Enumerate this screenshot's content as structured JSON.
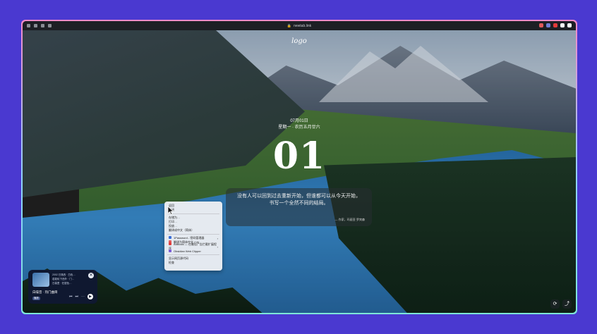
{
  "browser": {
    "url": "newtab.link",
    "extensions_colors": [
      "#e05a5a",
      "#6f7dd6",
      "#e23b3b",
      "#ffffff",
      "#ffffff"
    ]
  },
  "page": {
    "logo": "logo",
    "date_line1": "07月01日",
    "date_line2": "星期一 · 农历五月廿六",
    "big_number": "01",
    "quote_line1": "没有人可以回到过去重新开始，但谁都可以从今天开始，",
    "quote_line2": "书写一个全然不同的结局。",
    "quote_author": "— 作家，玛丽亚·罗宾森"
  },
  "context_menu": {
    "items": [
      "返回",
      "前进",
      "",
      "存储为…",
      "打印…",
      "投放…",
      "翻译成中文（简体）",
      "",
      "1Password - 密码管理器",
      "翻译为简体中文 (^A)",
      "AdBlock — 在最佳广告拦截扩展程序",
      "Obsidian Web Clipper",
      "",
      "显示网页源代码",
      "检查"
    ]
  },
  "player": {
    "lyrics": [
      "2002 日落西 · 白色…",
      "若能轮下西外 · 门…",
      "日暮里 · 在银色…"
    ],
    "song": "白噪音 · 热门曲目",
    "badge": "播放",
    "controls": {
      "prev": "⏮",
      "next": "⏭",
      "more": "⋯",
      "play": "▶",
      "close": "✕"
    }
  },
  "fabs": {
    "refresh": "⟳",
    "share": "⤴"
  }
}
